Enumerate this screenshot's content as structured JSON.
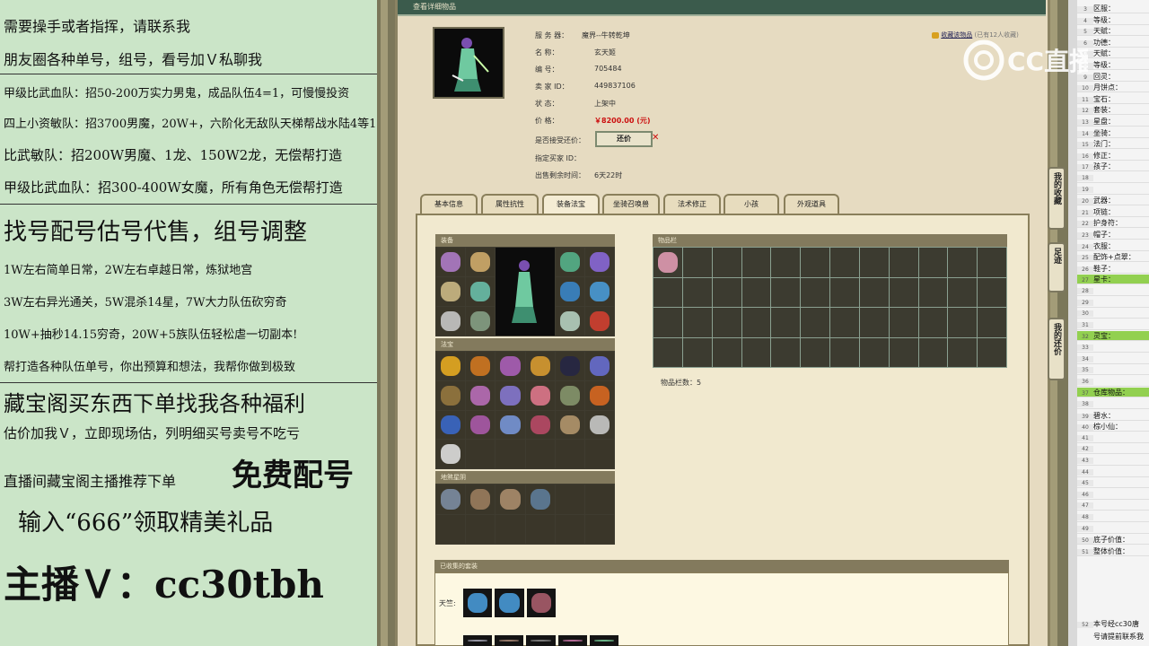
{
  "left_panel": {
    "lines": [
      "需要操手或者指挥，请联系我",
      "朋友圈各种单号，组号，看号加Ｖ私聊我",
      "甲级比武血队：招50-200万实力男鬼，成品队伍4=1，可慢慢投资",
      "四上小资敏队：招3700男魔，20W+，六阶化无敌队天梯帮战水陆4等1",
      "比武敏队：招200W男魔、1龙、150W2龙，无偿帮打造",
      "甲级比武血队：招300-400W女魔，所有角色无偿帮打造",
      "找号配号估号代售，组号调整",
      "1W左右简单日常，2W左右卓越日常，炼狱地宫",
      "3W左右异光通关，5W混杀14星，7W大力队伍砍穷奇",
      "10W+抽秒14.15穷奇，20W+5族队伍轻松虐一切副本!",
      "帮打造各种队伍单号，你出预算和想法，我帮你做到极致",
      "藏宝阁买东西下单找我各种福利",
      "估价加我Ｖ，立即现场估，列明细买号卖号不吃亏",
      "直播间藏宝阁主播推荐下单",
      "免费配号",
      "输入“666”领取精美礼品",
      "主播Ｖ：cc30tbh"
    ]
  },
  "window": {
    "title": "查看详细物品",
    "favorite_link": "收藏该物品",
    "favorite_count": "(已有12人收藏)",
    "info": [
      {
        "label": "服 务 器：",
        "value": "魔界--牛转乾坤"
      },
      {
        "label": "名        称：",
        "value": "玄天姬"
      },
      {
        "label": "编        号：",
        "value": "705484"
      },
      {
        "label": "卖 家 ID：",
        "value": "449837106"
      },
      {
        "label": "状        态：",
        "value": "上架中"
      },
      {
        "label": "价        格：",
        "value": "￥8200.00 (元)"
      }
    ],
    "bargain_label": "是否接受还价：",
    "bargain_button": "还价",
    "buyer_id_label": "指定买家 ID：",
    "time_left_label": "出售剩余时间：",
    "time_left_value": "6天22时"
  },
  "tabs": [
    "基本信息",
    "属性抗性",
    "装备法宝",
    "坐骑召唤兽",
    "法术修正",
    "小孩",
    "外观道具"
  ],
  "active_tab": "装备法宝",
  "sections": {
    "equipment": "装备",
    "treasures": "法宝",
    "talismans": "地煞星阴",
    "inventory": "物品栏",
    "inventory_count": "物品栏数：5",
    "suits": "已收集的套装",
    "suit_row_label": "天竺:"
  },
  "side_tabs": [
    "我的收藏",
    "足迹",
    "我的还价"
  ],
  "logo_text": "CC直播",
  "sheet_rows": [
    {
      "n": "3",
      "t": "区服："
    },
    {
      "n": "4",
      "t": "等级："
    },
    {
      "n": "5",
      "t": "天赋："
    },
    {
      "n": "6",
      "t": "功德："
    },
    {
      "n": "7",
      "t": "天赋："
    },
    {
      "n": "8",
      "t": "等级："
    },
    {
      "n": "9",
      "t": "回灵："
    },
    {
      "n": "10",
      "t": "月饼点："
    },
    {
      "n": "11",
      "t": "宝石："
    },
    {
      "n": "12",
      "t": "套装："
    },
    {
      "n": "13",
      "t": "星盘："
    },
    {
      "n": "14",
      "t": "坐骑："
    },
    {
      "n": "15",
      "t": "法门："
    },
    {
      "n": "16",
      "t": "修正："
    },
    {
      "n": "17",
      "t": "孩子："
    },
    {
      "n": "18",
      "t": ""
    },
    {
      "n": "19",
      "t": ""
    },
    {
      "n": "20",
      "t": "武器："
    },
    {
      "n": "21",
      "t": "项链："
    },
    {
      "n": "22",
      "t": "护身符："
    },
    {
      "n": "23",
      "t": "帽子："
    },
    {
      "n": "24",
      "t": "衣服："
    },
    {
      "n": "25",
      "t": "配饰+点翠："
    },
    {
      "n": "26",
      "t": "鞋子："
    },
    {
      "n": "27",
      "t": "星卡：",
      "hl": true
    },
    {
      "n": "28",
      "t": ""
    },
    {
      "n": "29",
      "t": ""
    },
    {
      "n": "30",
      "t": ""
    },
    {
      "n": "31",
      "t": ""
    },
    {
      "n": "32",
      "t": "灵宝：",
      "hl": true
    },
    {
      "n": "33",
      "t": ""
    },
    {
      "n": "34",
      "t": ""
    },
    {
      "n": "35",
      "t": ""
    },
    {
      "n": "36",
      "t": ""
    },
    {
      "n": "37",
      "t": "仓库物品：",
      "hl": true
    },
    {
      "n": "38",
      "t": ""
    },
    {
      "n": "39",
      "t": "碧水："
    },
    {
      "n": "40",
      "t": "棕小仙："
    },
    {
      "n": "41",
      "t": ""
    },
    {
      "n": "42",
      "t": ""
    },
    {
      "n": "43",
      "t": ""
    },
    {
      "n": "44",
      "t": ""
    },
    {
      "n": "45",
      "t": ""
    },
    {
      "n": "46",
      "t": ""
    },
    {
      "n": "47",
      "t": ""
    },
    {
      "n": "48",
      "t": ""
    },
    {
      "n": "49",
      "t": ""
    },
    {
      "n": "50",
      "t": "底子价值："
    },
    {
      "n": "51",
      "t": "整体价值："
    }
  ],
  "sheet_footer": [
    "本号经cc30唐",
    "号请提前联系我"
  ],
  "sheet_footer_row": "52",
  "colors": {
    "panel_bg": "#cbe5c8",
    "window_bg": "#e6dbc1",
    "title_bar": "#3b5b4c",
    "price_red": "#cc1010",
    "sheet_highlight": "#92d050"
  }
}
